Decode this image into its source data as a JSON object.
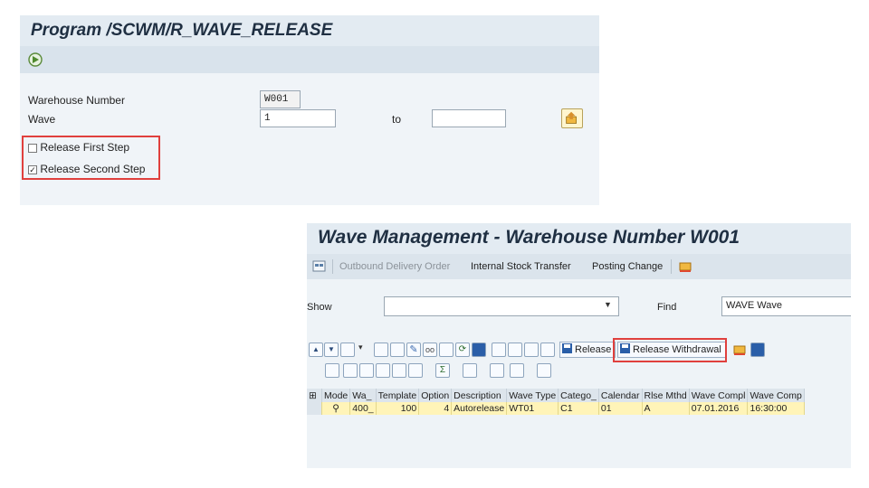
{
  "program_window": {
    "title": "Program /SCWM/R_WAVE_RELEASE",
    "fields": {
      "warehouse_label": "Warehouse Number",
      "warehouse_value": "W001",
      "wave_label": "Wave",
      "wave_from": "1",
      "to_label": "to",
      "wave_to": ""
    },
    "checkboxes": [
      {
        "label": "Release First Step",
        "checked": false
      },
      {
        "label": "Release Second Step",
        "checked": true
      }
    ]
  },
  "wave_window": {
    "title": "Wave Management - Warehouse Number W001",
    "menu": [
      {
        "label": "Outbound Delivery Order",
        "enabled": false
      },
      {
        "label": "Internal Stock Transfer",
        "enabled": true
      },
      {
        "label": "Posting Change",
        "enabled": true
      }
    ],
    "show_label": "Show",
    "show_value": "",
    "find_label": "Find",
    "find_value": "WAVE Wave",
    "buttons": {
      "release": "Release",
      "release_withdrawal": "Release Withdrawal"
    },
    "table": {
      "headers": [
        "Mode",
        "Wa_",
        "Template",
        "Option",
        "Description",
        "Wave Type",
        "Catego_",
        "Calendar",
        "Rlse Mthd",
        "Wave Compl",
        "Wave Comp"
      ],
      "rows": [
        [
          "",
          "400_",
          "100",
          "4",
          "Autorelease",
          "WT01",
          "C1",
          "01",
          "A",
          "07.01.2016",
          "16:30:00"
        ]
      ]
    }
  },
  "colors": {
    "highlight_red": "#e0403d",
    "row_yellow": "#fff4b8",
    "title_text": "#1f2f42"
  }
}
